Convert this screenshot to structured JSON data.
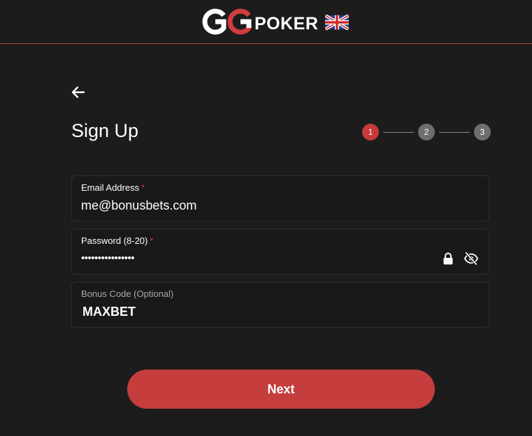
{
  "header": {
    "logo_mark": "GG",
    "logo_text": "POKER",
    "flag_icon": "uk-flag-icon"
  },
  "back": {
    "icon": "arrow-left-icon"
  },
  "title": "Sign Up",
  "stepper": {
    "steps": [
      "1",
      "2",
      "3"
    ],
    "active_step": 1,
    "active_color": "#c53a3a",
    "inactive_color": "#6e6e6e"
  },
  "form": {
    "email": {
      "label": "Email Address",
      "required_mark": "*",
      "value": "me@bonusbets.com"
    },
    "password": {
      "label": "Password (8-20)",
      "required_mark": "*",
      "value": "••••••••••••••••",
      "lock_icon": "lock-icon",
      "visibility_icon": "eye-off-icon"
    },
    "bonus_code": {
      "label": "Bonus Code (Optional)",
      "value": "MAXBET"
    }
  },
  "next_button": {
    "label": "Next",
    "color": "#c53d3d"
  }
}
